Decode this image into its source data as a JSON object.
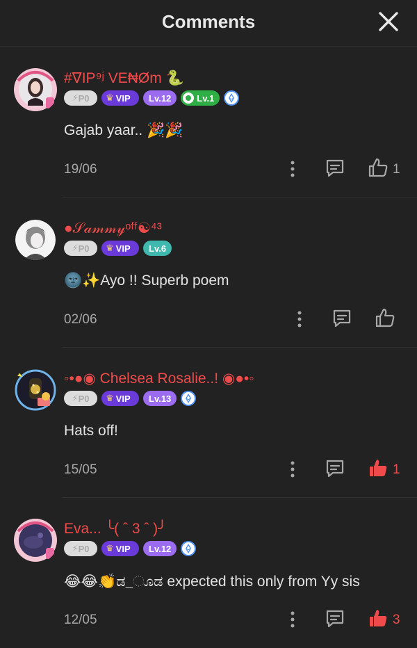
{
  "header": {
    "title": "Comments"
  },
  "comments": [
    {
      "username": "#∇IP⁹ʲ VE₦Øm 🐍",
      "badges": {
        "p0": "P0",
        "vip": "VIP",
        "level": "Lv.12",
        "extra": "Lv.1"
      },
      "text": "Gajab yaar.. 🎉🎉",
      "date": "19/06",
      "likes": "1",
      "liked": false
    },
    {
      "username": "●𝒮𝒶𝓂𝓂𝓎ᵒᶠᶠ☯⁴³",
      "badges": {
        "p0": "P0",
        "vip": "VIP",
        "level": "Lv.6"
      },
      "text": "🌚✨Ayo !! Superb poem",
      "date": "02/06",
      "likes": "",
      "liked": false
    },
    {
      "username": "◦•●◉ Chelsea Rosalie..! ◉●•◦",
      "badges": {
        "p0": "P0",
        "vip": "VIP",
        "level": "Lv.13"
      },
      "text": "Hats off!",
      "date": "15/05",
      "likes": "1",
      "liked": true
    },
    {
      "username": "Eva... ╰( ˆ 3 ˆ )╯",
      "badges": {
        "p0": "P0",
        "vip": "VIP",
        "level": "Lv.12"
      },
      "text": "😂😂👏ಡ_ೂಡ expected this only from Yy sis",
      "date": "12/05",
      "likes": "3",
      "liked": true
    }
  ],
  "colors": {
    "accent": "#ef4b4b",
    "background": "#222222",
    "vip": "#6a3bd9",
    "level": "#9b6cf0"
  }
}
